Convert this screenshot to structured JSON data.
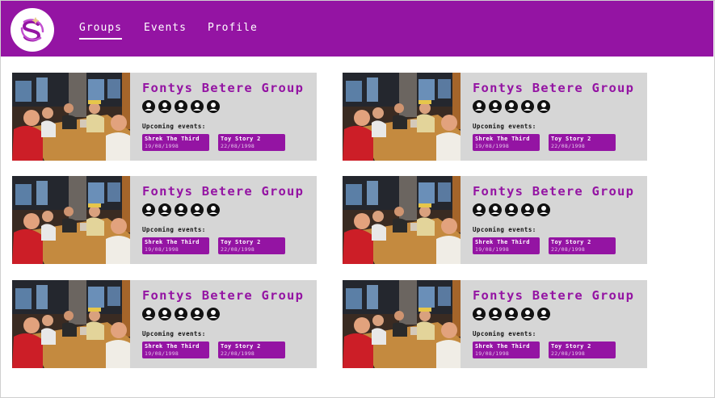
{
  "brand": {
    "accent": "#9414a3",
    "logo_icon": "stylized-s-swirl-logo"
  },
  "nav": {
    "items": [
      {
        "label": "Groups",
        "active": true
      },
      {
        "label": "Events",
        "active": false
      },
      {
        "label": "Profile",
        "active": false
      }
    ]
  },
  "groups": [
    {
      "name": "Fontys Betere Group",
      "photo_icon": "group-photo",
      "member_icons": [
        "user-avatar-icon",
        "user-avatar-icon",
        "user-avatar-icon",
        "user-avatar-icon",
        "user-avatar-icon"
      ],
      "upcoming_label": "Upcoming events:",
      "events": [
        {
          "title": "Shrek The Third",
          "date": "19/08/1998"
        },
        {
          "title": "Toy Story 2",
          "date": "22/08/1998"
        }
      ]
    },
    {
      "name": "Fontys Betere Group",
      "photo_icon": "group-photo",
      "member_icons": [
        "user-avatar-icon",
        "user-avatar-icon",
        "user-avatar-icon",
        "user-avatar-icon",
        "user-avatar-icon"
      ],
      "upcoming_label": "Upcoming events:",
      "events": [
        {
          "title": "Shrek The Third",
          "date": "19/08/1998"
        },
        {
          "title": "Toy Story 2",
          "date": "22/08/1998"
        }
      ]
    },
    {
      "name": "Fontys Betere Group",
      "photo_icon": "group-photo",
      "member_icons": [
        "user-avatar-icon",
        "user-avatar-icon",
        "user-avatar-icon",
        "user-avatar-icon",
        "user-avatar-icon"
      ],
      "upcoming_label": "Upcoming events:",
      "events": [
        {
          "title": "Shrek The Third",
          "date": "19/08/1998"
        },
        {
          "title": "Toy Story 2",
          "date": "22/08/1998"
        }
      ]
    },
    {
      "name": "Fontys Betere Group",
      "photo_icon": "group-photo",
      "member_icons": [
        "user-avatar-icon",
        "user-avatar-icon",
        "user-avatar-icon",
        "user-avatar-icon",
        "user-avatar-icon"
      ],
      "upcoming_label": "Upcoming events:",
      "events": [
        {
          "title": "Shrek The Third",
          "date": "19/08/1998"
        },
        {
          "title": "Toy Story 2",
          "date": "22/08/1998"
        }
      ]
    },
    {
      "name": "Fontys Betere Group",
      "photo_icon": "group-photo",
      "member_icons": [
        "user-avatar-icon",
        "user-avatar-icon",
        "user-avatar-icon",
        "user-avatar-icon",
        "user-avatar-icon"
      ],
      "upcoming_label": "Upcoming events:",
      "events": [
        {
          "title": "Shrek The Third",
          "date": "19/08/1998"
        },
        {
          "title": "Toy Story 2",
          "date": "22/08/1998"
        }
      ]
    },
    {
      "name": "Fontys Betere Group",
      "photo_icon": "group-photo",
      "member_icons": [
        "user-avatar-icon",
        "user-avatar-icon",
        "user-avatar-icon",
        "user-avatar-icon",
        "user-avatar-icon"
      ],
      "upcoming_label": "Upcoming events:",
      "events": [
        {
          "title": "Shrek The Third",
          "date": "19/08/1998"
        },
        {
          "title": "Toy Story 2",
          "date": "22/08/1998"
        }
      ]
    }
  ]
}
